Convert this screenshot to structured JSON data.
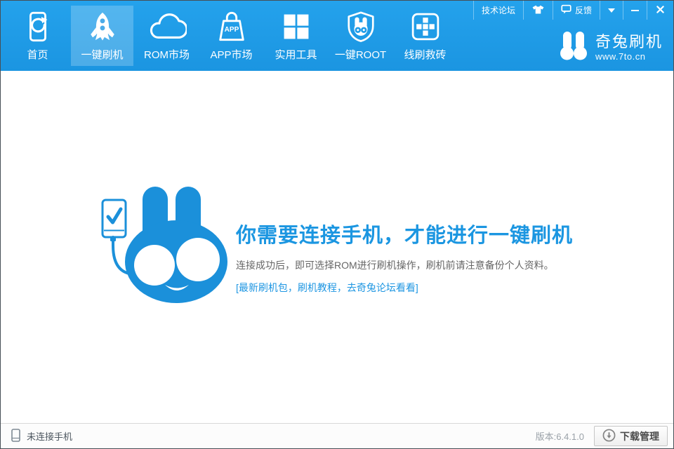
{
  "colors": {
    "header_blue": "#1f9de9",
    "active_tab_overlay": "rgba(255,255,255,0.22)",
    "brand_blue": "#1b90da",
    "heading_blue": "#1b96e1",
    "link_blue": "#1e96e2"
  },
  "titlebar": {
    "forum_label": "技术论坛",
    "feedback_label": "反馈",
    "icons": [
      "tshirt-skin-icon",
      "feedback-bubble-icon",
      "dropdown-caret-icon",
      "minimize-icon",
      "close-icon"
    ]
  },
  "nav": {
    "items": [
      {
        "label": "首页",
        "icon": "home-phone-refresh-icon",
        "active": false
      },
      {
        "label": "一键刷机",
        "icon": "rocket-icon",
        "active": true
      },
      {
        "label": "ROM市场",
        "icon": "cloud-icon",
        "active": false
      },
      {
        "label": "APP市场",
        "icon": "app-bag-icon",
        "active": false
      },
      {
        "label": "实用工具",
        "icon": "tools-grid-icon",
        "active": false
      },
      {
        "label": "一键ROOT",
        "icon": "root-shield-icon",
        "active": false
      },
      {
        "label": "线刷救砖",
        "icon": "brick-rescue-icon",
        "active": false
      }
    ],
    "bag_text": "APP"
  },
  "logo": {
    "brand": "奇兔刷机",
    "site": "www.7to.cn"
  },
  "hero": {
    "heading": "你需要连接手机，才能进行一键刷机",
    "description": "连接成功后，即可选择ROM进行刷机操作，刷机前请注意备份个人资料。",
    "link": "[最新刷机包，刷机教程，去奇兔论坛看看]"
  },
  "footer": {
    "status": "未连接手机",
    "version": "版本:6.4.1.0",
    "download_label": "下载管理"
  }
}
